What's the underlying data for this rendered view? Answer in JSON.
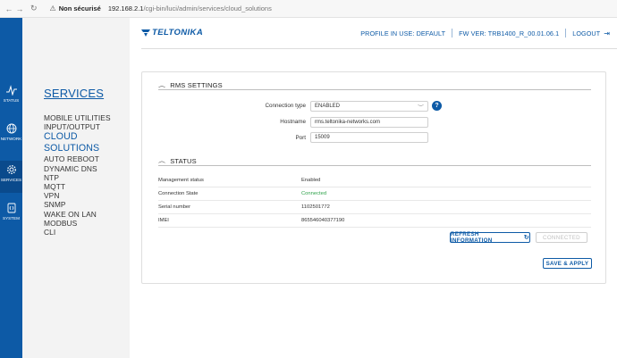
{
  "browser": {
    "back": "←",
    "forward": "→",
    "reload": "↻",
    "insecure_label": "Non sécurisé",
    "url_host": "192.168.2.1",
    "url_path": "/cgi-bin/luci/admin/services/cloud_solutions"
  },
  "rail": {
    "items": [
      {
        "label": "STATUS",
        "icon": "pulse-icon"
      },
      {
        "label": "NETWORK",
        "icon": "globe-icon"
      },
      {
        "label": "SERVICES",
        "icon": "gear-icon"
      },
      {
        "label": "SYSTEM",
        "icon": "system-icon"
      }
    ]
  },
  "sidebar": {
    "title": "SERVICES",
    "items": [
      "MOBILE UTILITIES",
      "INPUT/OUTPUT",
      "CLOUD SOLUTIONS",
      "AUTO REBOOT",
      "DYNAMIC DNS",
      "NTP",
      "MQTT",
      "VPN",
      "SNMP",
      "WAKE ON LAN",
      "MODBUS",
      "CLI"
    ],
    "active_index": 2
  },
  "header": {
    "logo": "TELTONIKA",
    "profile": "PROFILE IN USE: DEFAULT",
    "fw": "FW VER: TRB1400_R_00.01.06.1",
    "logout": "LOGOUT"
  },
  "rms": {
    "title": "RMS SETTINGS",
    "connection_type_label": "Connection type",
    "connection_type_value": "ENABLED",
    "help": "?",
    "hostname_label": "Hostname",
    "hostname_value": "rms.teltonika-networks.com",
    "port_label": "Port",
    "port_value": "15009"
  },
  "status": {
    "title": "STATUS",
    "rows": [
      {
        "k": "Management status",
        "v": "Enabled"
      },
      {
        "k": "Connection State",
        "v": "Connected"
      },
      {
        "k": "Serial number",
        "v": "1102501772"
      },
      {
        "k": "IMEI",
        "v": "865546040377190"
      }
    ],
    "refresh_label": "REFRESH INFORMATION",
    "connected_button": "CONNECTED",
    "save_label": "SAVE & APPLY"
  },
  "colors": {
    "brand": "#0d5aa6",
    "connected": "#2ea24a"
  }
}
